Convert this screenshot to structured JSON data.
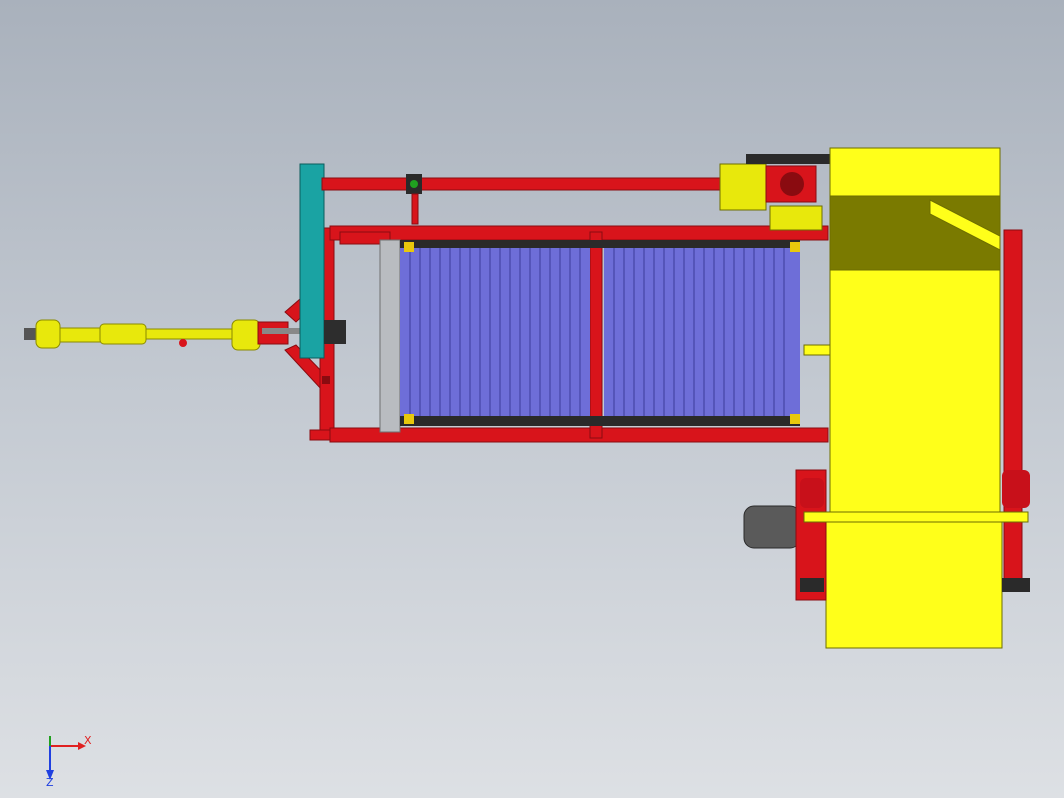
{
  "viewport": {
    "background_top": "#a9b1bc",
    "background_bottom": "#dde0e4"
  },
  "model": {
    "colors": {
      "frame_red": "#d8141b",
      "frame_red_dark": "#8a0b10",
      "hopper_yellow": "#ffff1a",
      "hopper_yellow_dark": "#b8b800",
      "drive_yellow": "#e8e80c",
      "conveyor_blue": "#6e6ed8",
      "conveyor_dark": "#3c3c9a",
      "chain_black": "#2a2a2a",
      "plate_teal": "#1aa3a3",
      "tire_gray": "#5a5a5a",
      "shield_gray": "#b9bcc0"
    }
  },
  "triad": {
    "x_label": "X",
    "z_label": "Z",
    "x_color": "#e02020",
    "y_color": "#20a020",
    "z_color": "#2040e0"
  }
}
